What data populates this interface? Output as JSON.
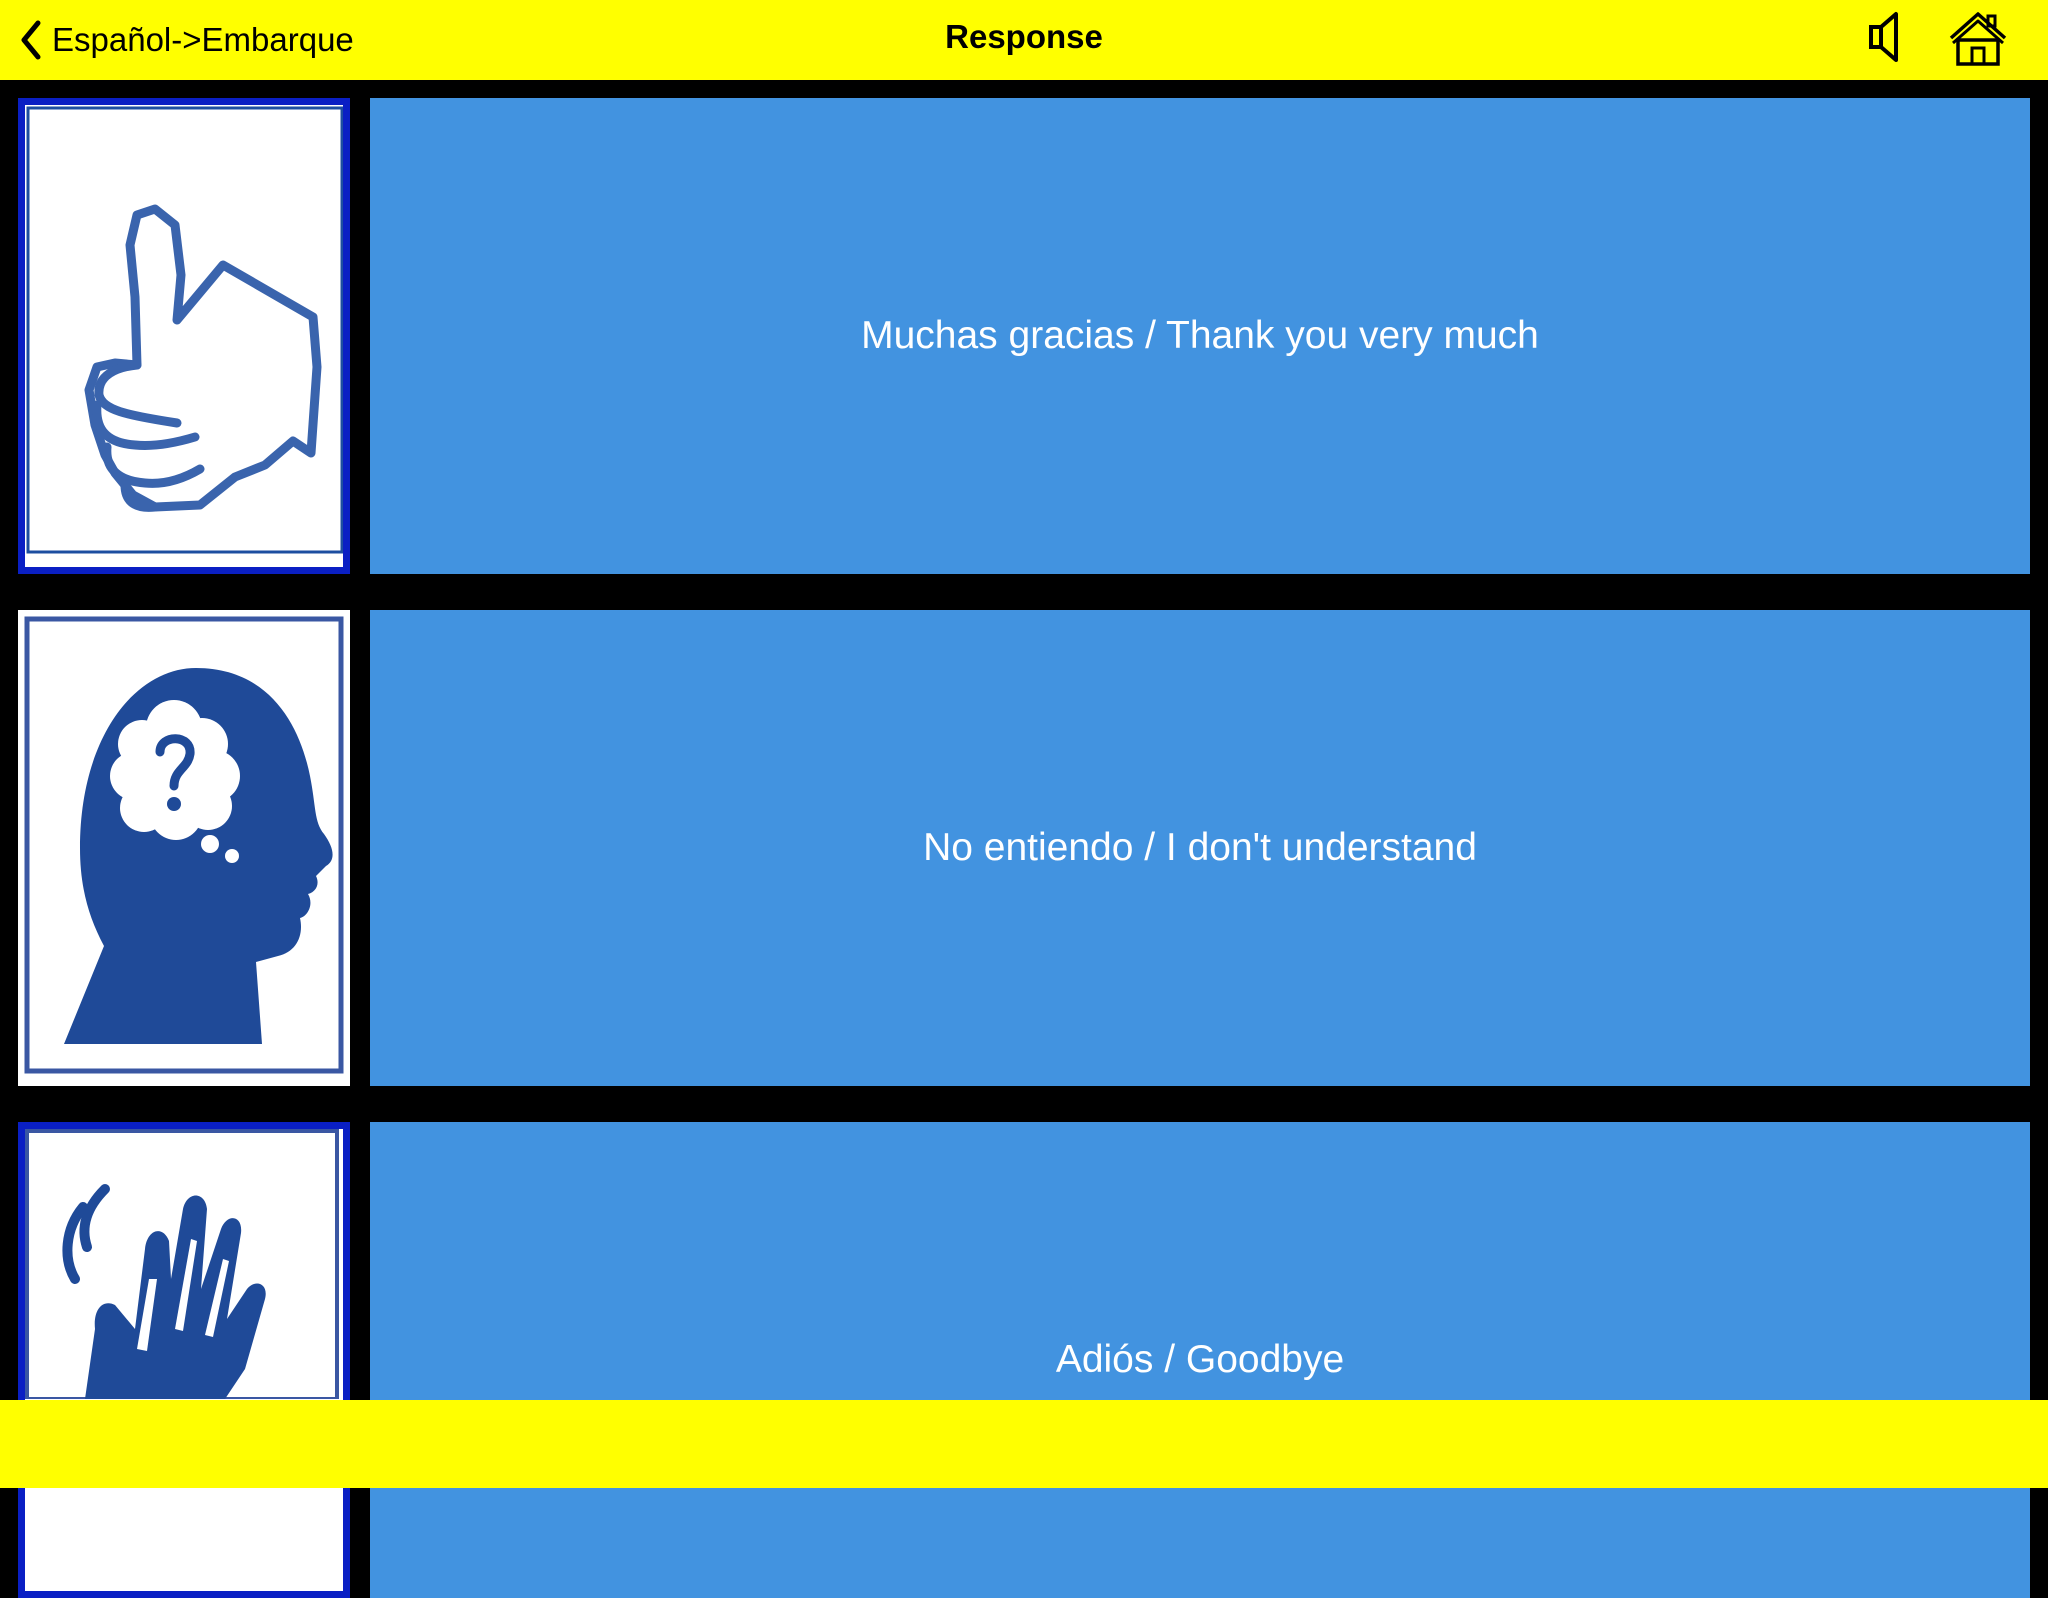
{
  "navbar": {
    "back_label": "Español->Embarque",
    "title": "Response",
    "speaker_icon": "speaker-icon",
    "home_icon": "home-icon"
  },
  "rows": [
    {
      "phrase": "Muchas gracias / Thank you very much",
      "icon": "thumbs-up-icon"
    },
    {
      "phrase": "No entiendo / I don't understand",
      "icon": "confused-head-icon"
    },
    {
      "phrase": "Adiós / Goodbye",
      "icon": "waving-hand-icon"
    }
  ],
  "colors": {
    "bar_background": "#ffff00",
    "tile_background": "#4293e0",
    "tile_text": "#ffffff",
    "icon_blue": "#3a64ad",
    "selected_border": "#0a1fc4"
  }
}
